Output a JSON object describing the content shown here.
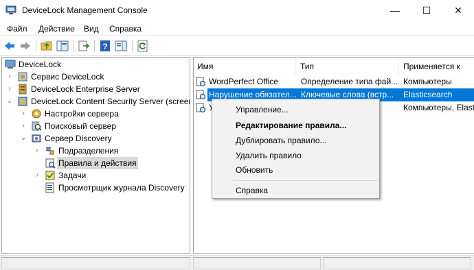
{
  "window": {
    "title": "DeviceLock Management Console",
    "minimize": "—",
    "maximize": "☐",
    "close": "✕"
  },
  "menu": {
    "items": [
      "Файл",
      "Действие",
      "Вид",
      "Справка"
    ]
  },
  "toolbar": {
    "icons": [
      "back-arrow-icon",
      "forward-arrow-icon",
      "up-folder-icon",
      "show-tree-icon",
      "export-icon",
      "help-icon",
      "action-pane-icon",
      "refresh-icon"
    ]
  },
  "tree": {
    "items": [
      {
        "label": "DeviceLock",
        "icon": "computer-icon",
        "expander": ""
      },
      {
        "label": "Сервис DeviceLock",
        "icon": "service-icon",
        "expander": "›"
      },
      {
        "label": "DeviceLock Enterprise Server",
        "icon": "server-icon",
        "expander": "›"
      },
      {
        "label": "DeviceLock Content Security Server (screen",
        "icon": "security-server-icon",
        "expander": "⌄"
      },
      {
        "label": "Настройки сервера",
        "icon": "gear-icon",
        "expander": "›"
      },
      {
        "label": "Поисковый сервер",
        "icon": "search-server-icon",
        "expander": "›"
      },
      {
        "label": "Сервер Discovery",
        "icon": "discovery-icon",
        "expander": "⌄"
      },
      {
        "label": "Подразделения",
        "icon": "units-icon",
        "expander": "›"
      },
      {
        "label": "Правила и действия",
        "icon": "rules-icon",
        "expander": ""
      },
      {
        "label": "Задачи",
        "icon": "tasks-icon",
        "expander": "›"
      },
      {
        "label": "Просмотрщик журнала Discovery",
        "icon": "log-viewer-icon",
        "expander": ""
      }
    ]
  },
  "list": {
    "columns": [
      "Имя",
      "Тип",
      "Применяется к"
    ],
    "rows": [
      {
        "name": "WordPerfect Office",
        "type": "Определение типа фай...",
        "applies": "Компьютеры",
        "selected": false
      },
      {
        "name": "Нарушение обязател...",
        "type": "Ключевые слова (встр...",
        "applies": "Elasticsearch",
        "selected": true
      },
      {
        "name": "У",
        "type": "",
        "applies": "Компьютеры, Elast",
        "selected": false
      }
    ]
  },
  "context_menu": {
    "items": [
      {
        "label": "Управление...",
        "bold": false
      },
      {
        "label": "Редактирование правила...",
        "bold": true
      },
      {
        "label": "Дублировать правило...",
        "bold": false
      },
      {
        "label": "Удалить правило",
        "bold": false
      },
      {
        "label": "Обновить",
        "bold": false
      },
      {
        "label": "Справка",
        "bold": false
      }
    ]
  },
  "colors": {
    "selection": "#0078d7",
    "tree_selection": "#d9d9d9"
  }
}
